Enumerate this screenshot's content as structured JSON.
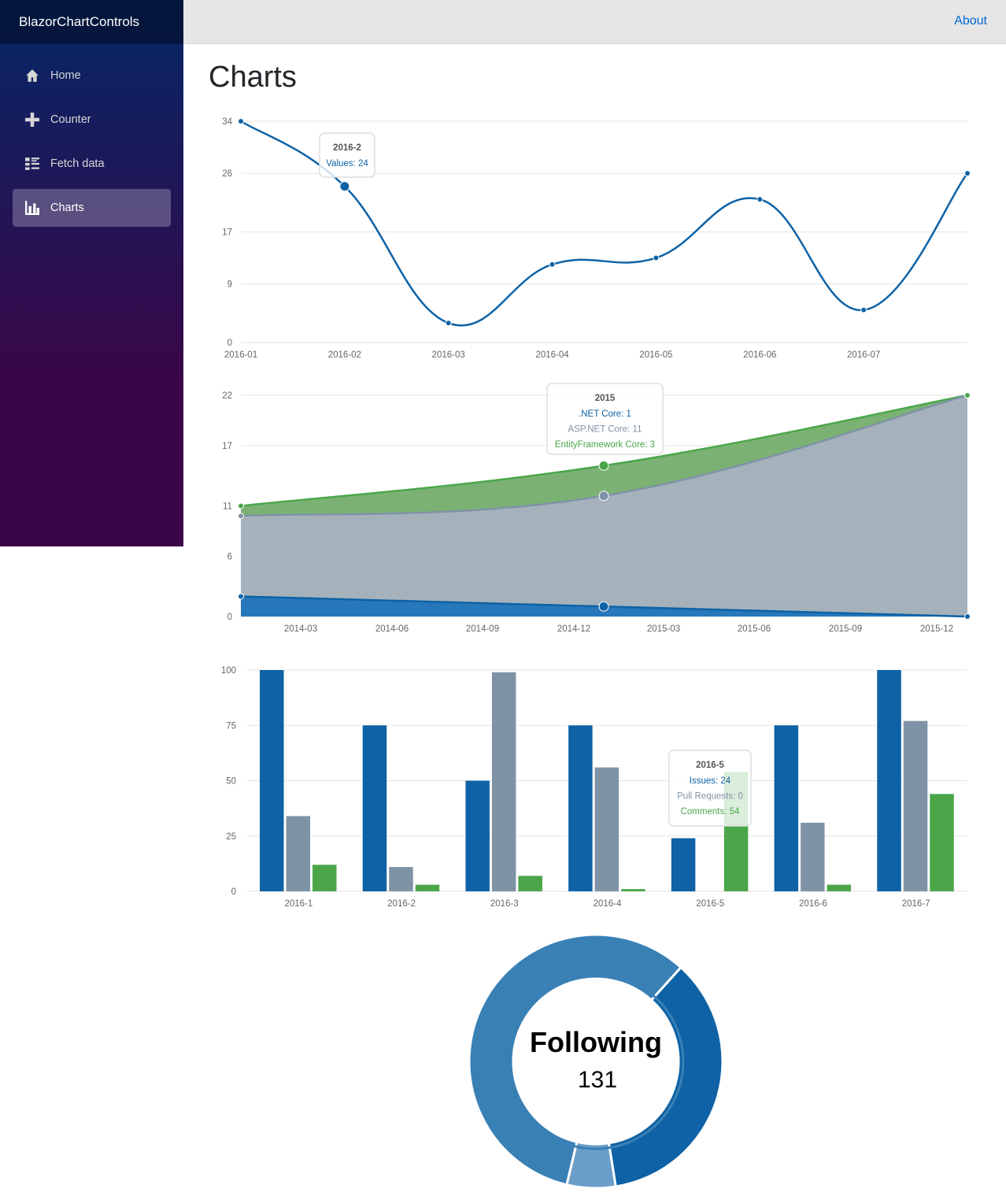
{
  "app": {
    "brand": "BlazorChartControls"
  },
  "topbar": {
    "about_label": "About"
  },
  "sidebar": {
    "items": [
      {
        "label": "Home",
        "icon": "home-icon",
        "active": false
      },
      {
        "label": "Counter",
        "icon": "plus-icon",
        "active": false
      },
      {
        "label": "Fetch data",
        "icon": "list-rich-icon",
        "active": false
      },
      {
        "label": "Charts",
        "icon": "bar-chart-icon",
        "active": true
      }
    ]
  },
  "page": {
    "title": "Charts"
  },
  "colors": {
    "blue": "#0e62a5",
    "gray": "#7f93a6",
    "green": "#4ba64a",
    "area_blue": "#2778bb",
    "area_gray": "#a5b2bb",
    "area_green": "#7bb274"
  },
  "chart_data": [
    {
      "type": "line",
      "categories": [
        "2016-01",
        "2016-02",
        "2016-03",
        "2016-04",
        "2016-05",
        "2016-06",
        "2016-07",
        ""
      ],
      "yticks": [
        "34",
        "26",
        "17",
        "9",
        "0"
      ],
      "ylim": [
        0,
        34
      ],
      "series": [
        {
          "name": "Values",
          "values": [
            34,
            24,
            3,
            12,
            13,
            22,
            5,
            26
          ]
        }
      ],
      "tooltip": {
        "title": "2016-2",
        "lines": [
          "Values: 24"
        ]
      }
    },
    {
      "type": "area",
      "xticks": [
        "2014-03",
        "2014-06",
        "2014-09",
        "2014-12",
        "2015-03",
        "2015-06",
        "2015-09",
        "2015-12"
      ],
      "yticks": [
        "22",
        "17",
        "11",
        "6",
        "0"
      ],
      "ylim": [
        0,
        22
      ],
      "stacked": true,
      "series": [
        {
          "name": ".NET Core",
          "values": [
            2,
            1,
            0
          ]
        },
        {
          "name": "ASP.NET Core",
          "values": [
            8,
            11,
            22
          ]
        },
        {
          "name": "EntityFramework Core",
          "values": [
            1,
            3,
            0
          ]
        }
      ],
      "tooltip": {
        "title": "2015",
        "lines": [
          ".NET Core: 1",
          "ASP.NET Core: 11",
          "EntityFramework Core: 3"
        ]
      }
    },
    {
      "type": "bar",
      "categories": [
        "2016-1",
        "2016-2",
        "2016-3",
        "2016-4",
        "2016-5",
        "2016-6",
        "2016-7"
      ],
      "yticks": [
        "100",
        "75",
        "50",
        "25",
        "0"
      ],
      "ylim": [
        0,
        100
      ],
      "series": [
        {
          "name": "Issues",
          "values": [
            100,
            75,
            50,
            75,
            24,
            75,
            100
          ]
        },
        {
          "name": "Pull Requests",
          "values": [
            34,
            11,
            99,
            56,
            0,
            31,
            77
          ]
        },
        {
          "name": "Comments",
          "values": [
            12,
            3,
            7,
            1,
            54,
            3,
            44
          ]
        }
      ],
      "tooltip": {
        "title": "2016-5",
        "lines": [
          "Issues: 24",
          "Pull Requests: 0",
          "Comments: 54"
        ]
      }
    },
    {
      "type": "pie",
      "center_title": "Following",
      "center_value": "131",
      "slices": [
        0.358,
        0.062,
        0.58
      ],
      "slice_colors": [
        "#0e62a5",
        "#6a9ec9",
        "#3980b5"
      ]
    }
  ]
}
